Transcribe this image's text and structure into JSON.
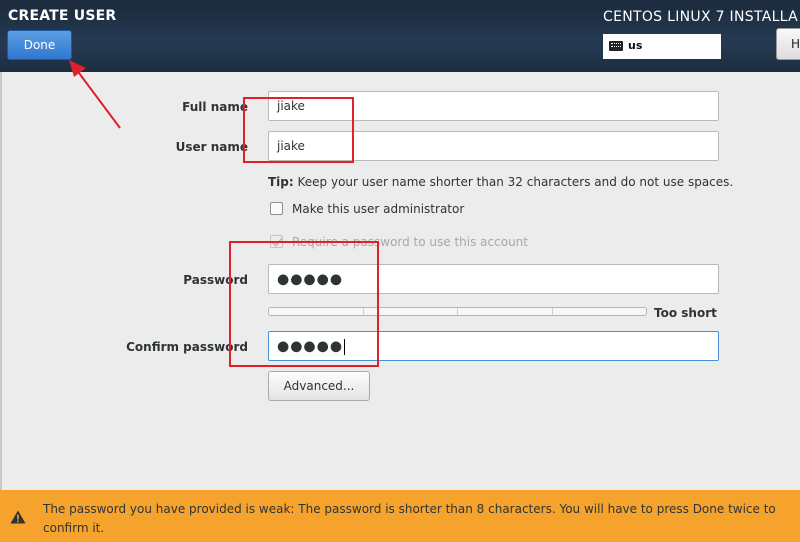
{
  "header": {
    "screen_title": "CREATE USER",
    "done_label": "Done",
    "product_title": "CENTOS LINUX 7 INSTALLA",
    "keyboard_layout": "us",
    "help_label": "H"
  },
  "form": {
    "full_name": {
      "label": "Full name",
      "value": "jiake"
    },
    "user_name": {
      "label": "User name",
      "value": "jiake"
    },
    "tip_bold": "Tip:",
    "tip_text": " Keep your user name shorter than 32 characters and do not use spaces.",
    "admin_checkbox": {
      "label": "Make this user administrator",
      "checked": false
    },
    "require_password_checkbox": {
      "label": "Require a password to use this account",
      "checked": true,
      "disabled": true
    },
    "password": {
      "label": "Password",
      "masked": "●●●●●"
    },
    "strength_label": "Too short",
    "strength_level": 0,
    "confirm_password": {
      "label": "Confirm password",
      "masked": "●●●●●"
    },
    "advanced_label": "Advanced..."
  },
  "warning": {
    "text": "The password you have provided is weak: The password is shorter than 8 characters. You will have to press Done twice to confirm it."
  },
  "colors": {
    "header_bg": "#1f3045",
    "done_button": "#3d85d8",
    "warning_bg": "#f6a32d",
    "annotation_red": "#e0202a"
  }
}
